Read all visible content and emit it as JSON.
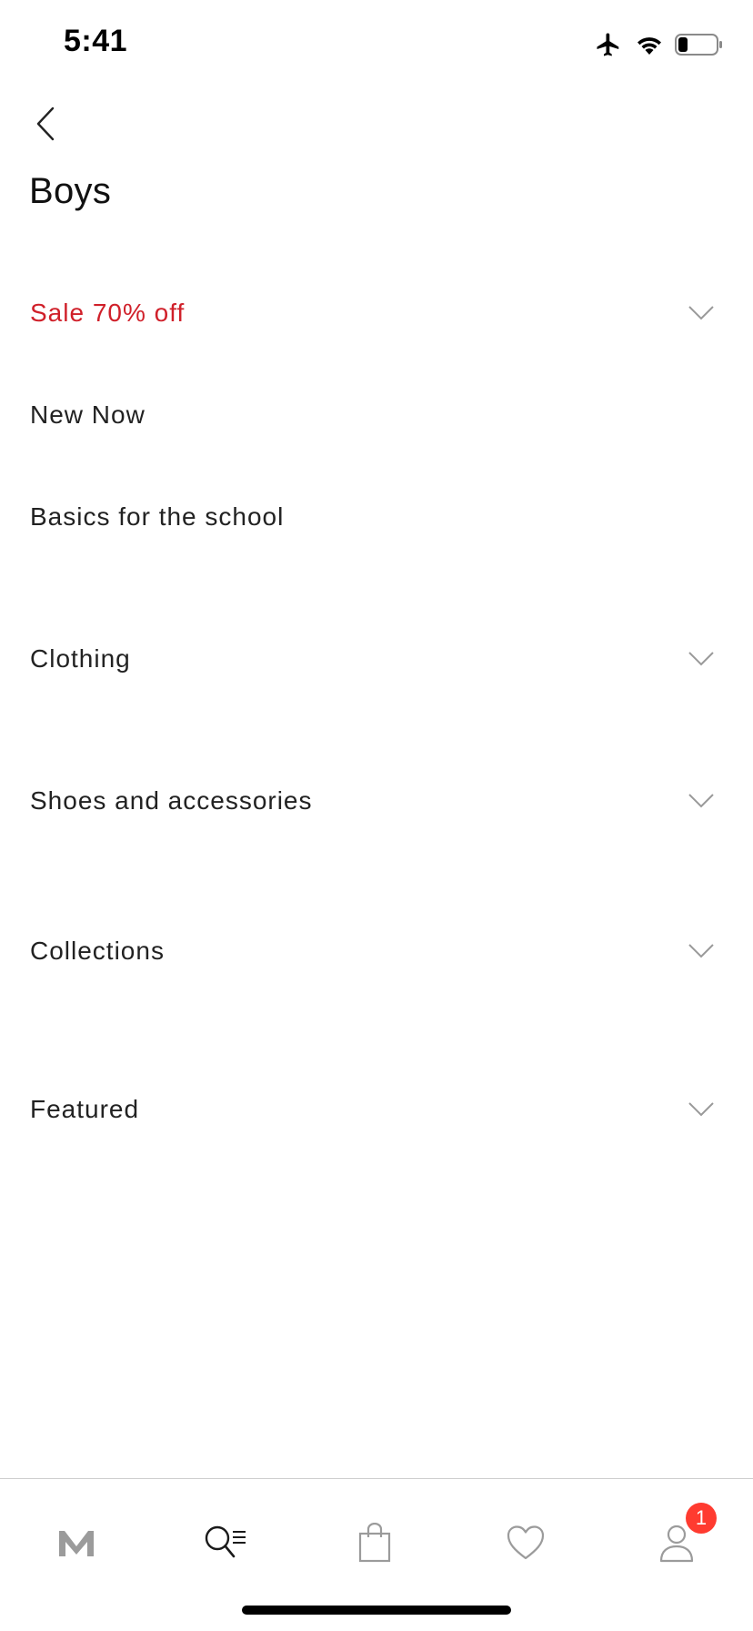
{
  "status_bar": {
    "time": "5:41"
  },
  "header": {
    "back_icon": "chevron-left-icon",
    "title": "Boys"
  },
  "menu": {
    "items": [
      {
        "label": "Sale 70% off",
        "expandable": true,
        "color": "#d0202a"
      },
      {
        "label": "New Now",
        "expandable": false
      },
      {
        "label": "Basics for the school",
        "expandable": false
      },
      {
        "label": "Clothing",
        "expandable": true
      },
      {
        "label": "Shoes and accessories",
        "expandable": true
      },
      {
        "label": "Collections",
        "expandable": true
      },
      {
        "label": "Featured",
        "expandable": true
      }
    ]
  },
  "tab_bar": {
    "tabs": [
      {
        "icon": "brand-logo-icon",
        "active": false
      },
      {
        "icon": "search-menu-icon",
        "active": true
      },
      {
        "icon": "shopping-bag-icon",
        "active": false
      },
      {
        "icon": "heart-icon",
        "active": false
      },
      {
        "icon": "profile-icon",
        "active": false,
        "badge": "1"
      }
    ]
  },
  "colors": {
    "sale": "#d0202a",
    "badge": "#ff3b30",
    "inactive_icon": "#9b9b9b",
    "active_icon": "#1a1a1a"
  }
}
